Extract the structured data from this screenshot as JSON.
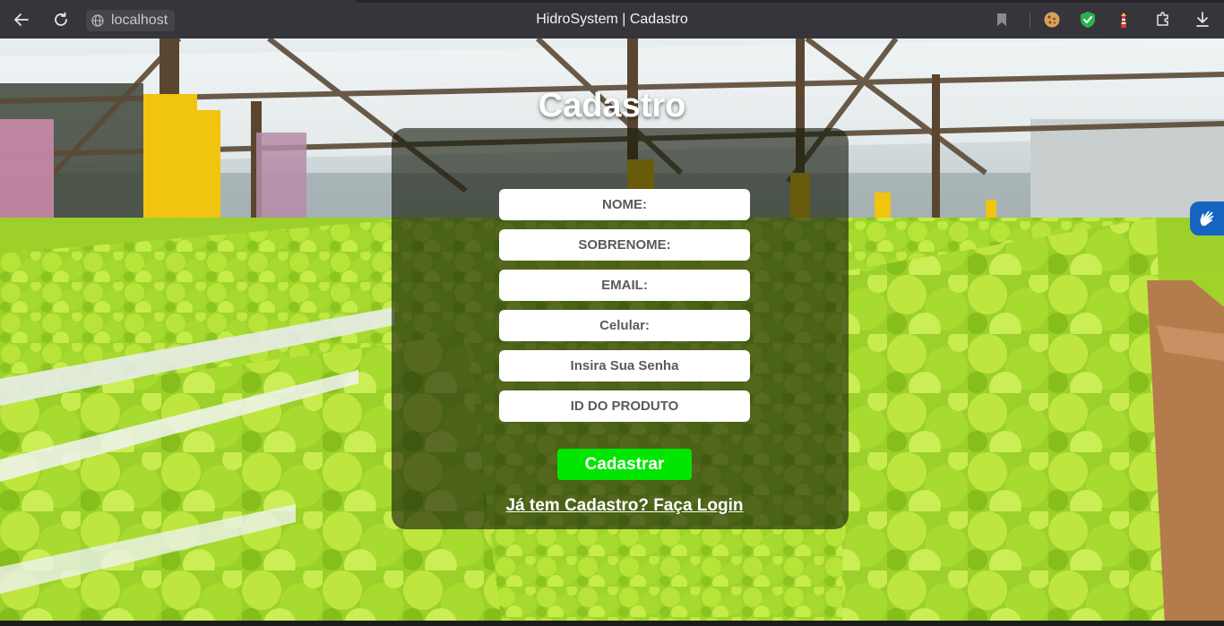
{
  "browser": {
    "window_title": "HidroSystem | Cadastro",
    "url": "localhost",
    "icons": {
      "back": "back-arrow-icon",
      "reload": "reload-icon",
      "site_info": "globe-icon",
      "bookmark": "bookmark-icon",
      "ext1": "cookie-icon",
      "ext2": "shield-check-icon",
      "ext3": "lighthouse-icon",
      "extensions": "extensions-icon",
      "downloads": "download-icon"
    }
  },
  "page": {
    "heading": "Cadastro",
    "form": {
      "fields": [
        {
          "name": "nome",
          "placeholder": "NOME:"
        },
        {
          "name": "sobrenome",
          "placeholder": "SOBRENOME:"
        },
        {
          "name": "email",
          "placeholder": "EMAIL:"
        },
        {
          "name": "celular",
          "placeholder": "Celular:"
        },
        {
          "name": "senha",
          "placeholder": "Insira Sua Senha"
        },
        {
          "name": "id-produto",
          "placeholder": "ID DO PRODUTO"
        }
      ],
      "submit_label": "Cadastrar",
      "login_link": "Já tem Cadastro? Faça Login"
    },
    "accessibility_widget": "sign-language-icon",
    "colors": {
      "submit": "#00e600",
      "card": "rgba(20,26,10,0.62)",
      "a11y": "#1565c0"
    }
  }
}
